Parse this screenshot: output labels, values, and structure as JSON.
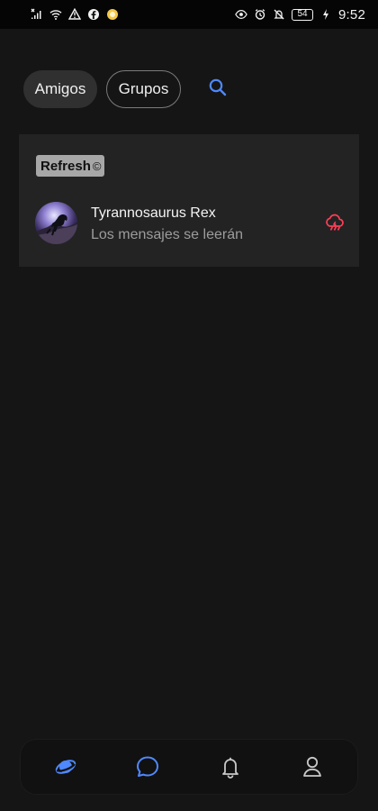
{
  "status_bar": {
    "battery": "54",
    "time": "9:52",
    "icons": [
      "signal-off-icon",
      "wifi-icon",
      "warning-icon",
      "facebook-icon",
      "notification-app-icon",
      "eye-icon",
      "alarm-icon",
      "mute-icon",
      "battery-icon",
      "charging-icon"
    ]
  },
  "tabs": {
    "amigos": "Amigos",
    "grupos": "Grupos"
  },
  "search": {
    "icon": "search-icon",
    "color": "#4f88ff"
  },
  "refresh": {
    "label": "Refresh",
    "mark": "©"
  },
  "chat": {
    "name": "Tyrannosaurus Rex",
    "preview": "Los mensajes se leerán",
    "status_icon": "storm-cloud-icon",
    "status_color": "#ff3f58"
  },
  "bottom_nav": {
    "items": [
      "planet-icon",
      "chat-icon",
      "bell-icon",
      "profile-icon"
    ],
    "active_color": "#4f88ff",
    "inactive_color": "#c8c8c8"
  }
}
